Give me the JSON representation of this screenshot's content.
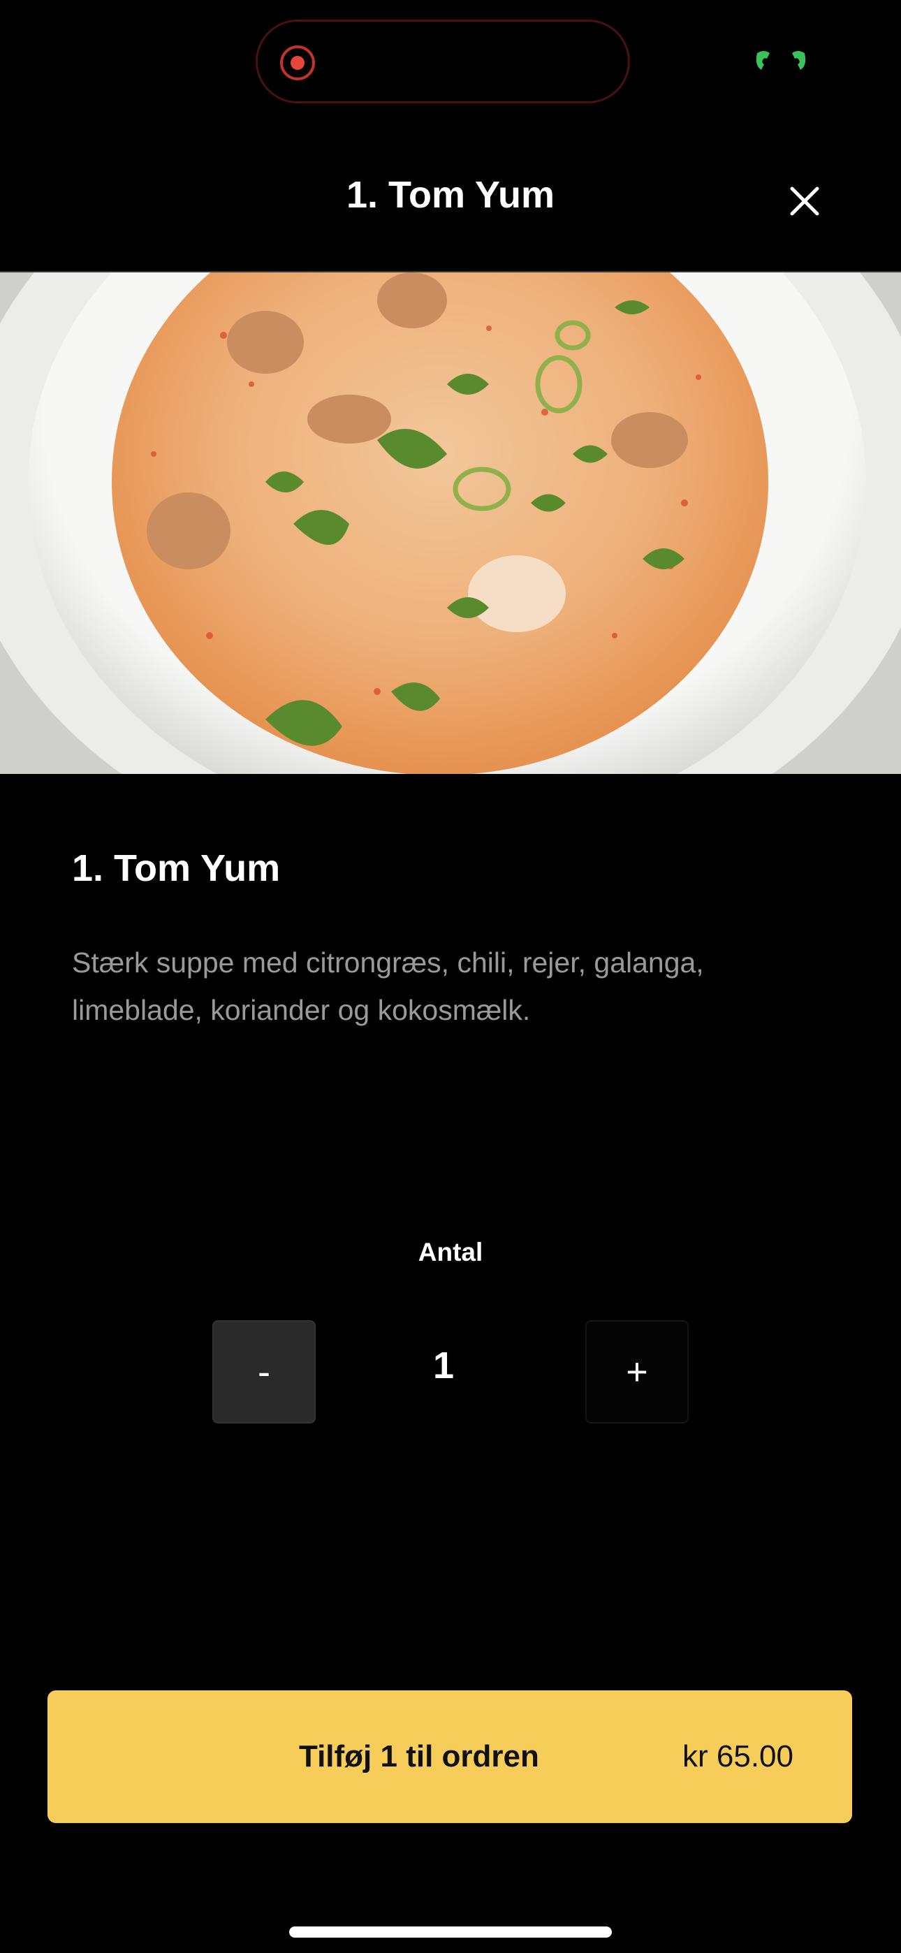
{
  "status_bar": {
    "icons": [
      "screen-recording-icon",
      "phone-call-indicator-icon"
    ],
    "accent_colors": {
      "recording": "#e8463a",
      "call": "#3ac35c"
    }
  },
  "header": {
    "title": "1. Tom Yum",
    "close_icon": "close-icon"
  },
  "hero_image": {
    "description_icon": "soup-image"
  },
  "item": {
    "title": "1. Tom Yum",
    "description": "Stærk suppe med citrongræs, chili, rejer, galanga, limeblade, koriander og kokosmælk."
  },
  "quantity": {
    "label": "Antal",
    "minus_label": "-",
    "value": "1",
    "plus_label": "+"
  },
  "add_button": {
    "label": "Tilføj 1 til ordren",
    "price": "kr 65.00",
    "color": "#f7cd5a"
  }
}
